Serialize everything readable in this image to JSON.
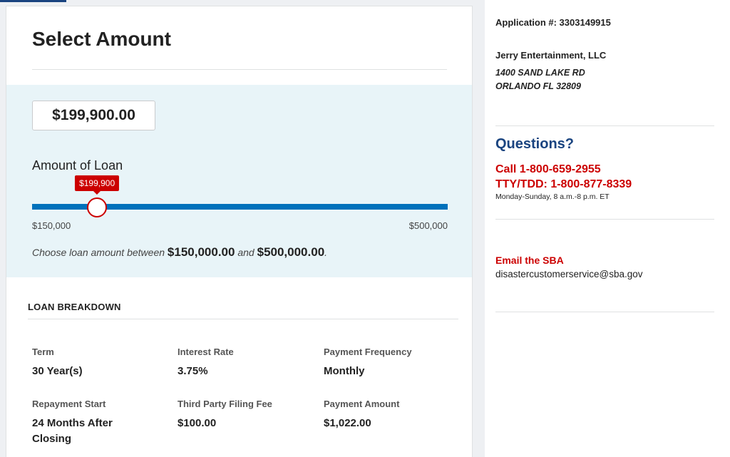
{
  "main": {
    "title": "Select Amount",
    "amount_value": "$199,900.00",
    "slider": {
      "label": "Amount of Loan",
      "tooltip": "$199,900",
      "min_label": "$150,000",
      "max_label": "$500,000",
      "min": 150000,
      "max": 500000,
      "value": 199900,
      "color_track": "#0071bb",
      "color_thumb": "#cc0000"
    },
    "range_note": {
      "prefix": "Choose loan amount between",
      "min": "$150,000.00",
      "joiner": "and",
      "max": "$500,000.00",
      "suffix": "."
    }
  },
  "breakdown": {
    "title": "LOAN BREAKDOWN",
    "fields": [
      {
        "label": "Term",
        "value": "30 Year(s)"
      },
      {
        "label": "Interest Rate",
        "value": "3.75%"
      },
      {
        "label": "Payment Frequency",
        "value": "Monthly"
      },
      {
        "label": "Repayment Start",
        "value": "24 Months After Closing"
      },
      {
        "label": "Third Party Filing Fee",
        "value": "$100.00"
      },
      {
        "label": "Payment Amount",
        "value": "$1,022.00"
      }
    ]
  },
  "sidebar": {
    "application": "Application #: 3303149915",
    "business_name": "Jerry Entertainment, LLC",
    "address_line1": "1400 SAND LAKE RD",
    "address_line2": "ORLANDO FL 32809",
    "questions_title": "Questions?",
    "call": "Call 1-800-659-2955",
    "tty": "TTY/TDD: 1-800-877-8339",
    "hours": "Monday-Sunday, 8 a.m.-8 p.m. ET",
    "email_label": "Email the SBA",
    "email": "disastercustomerservice@sba.gov"
  }
}
